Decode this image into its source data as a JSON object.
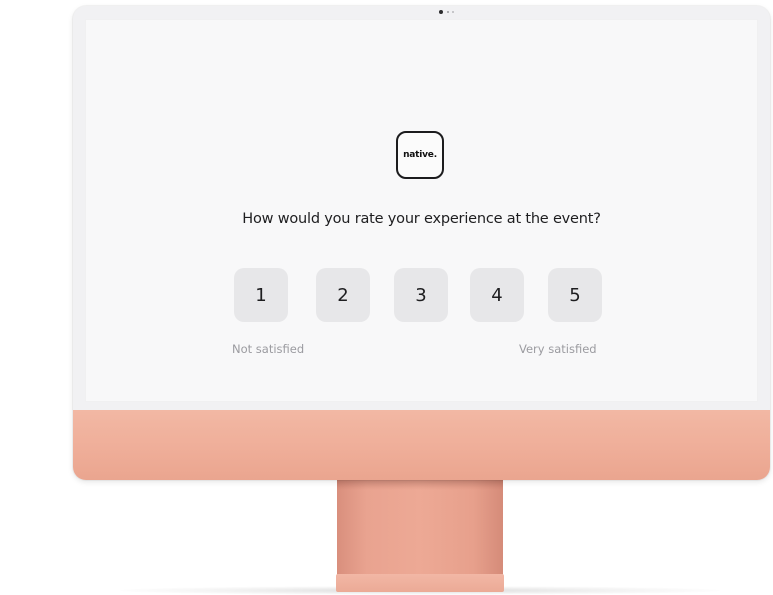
{
  "brand": {
    "logo_text": "native."
  },
  "survey": {
    "question": "How would you rate your experience at the event?",
    "options": [
      "1",
      "2",
      "3",
      "4",
      "5"
    ],
    "scale_min_label": "Not satisfied",
    "scale_max_label": "Very satisfied"
  },
  "colors": {
    "device_accent": "#efae99",
    "rating_button_bg": "#e7e7e9",
    "screen_bg": "#f8f8f9"
  }
}
